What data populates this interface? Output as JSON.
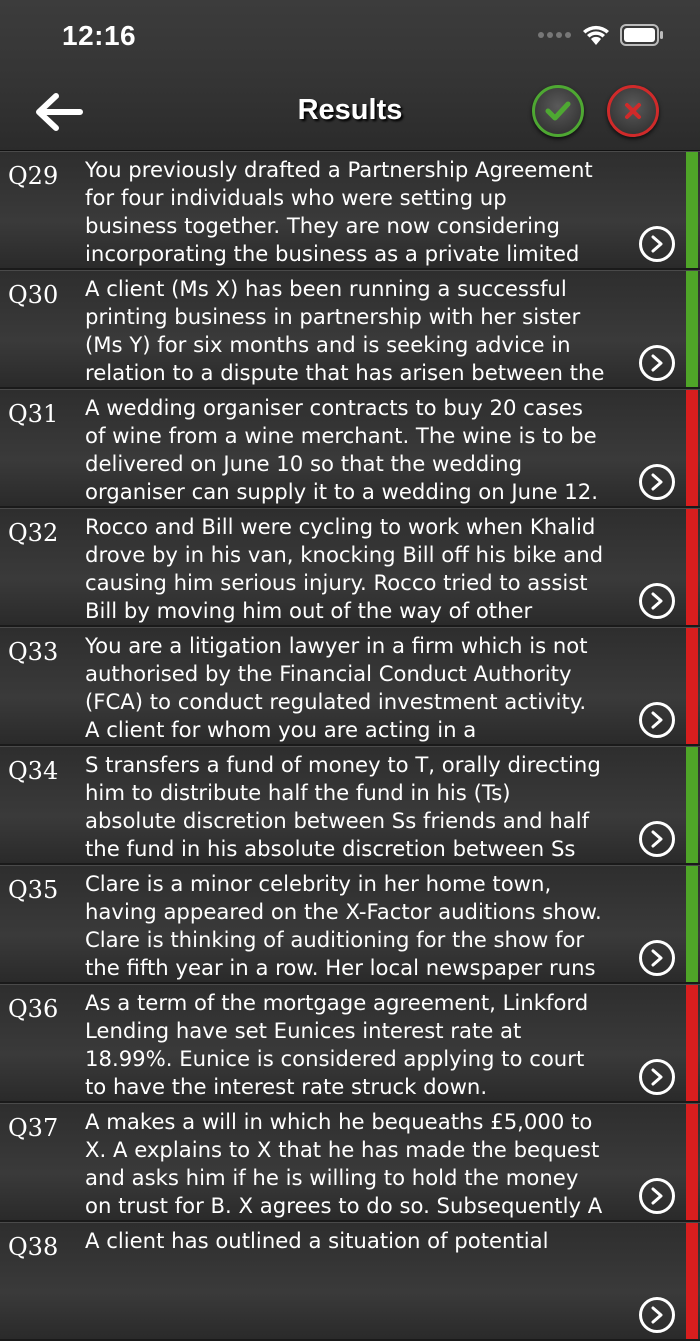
{
  "status": {
    "time": "12:16"
  },
  "header": {
    "title": "Results"
  },
  "colors": {
    "correct": "#4fa528",
    "incorrect": "#d81e1e"
  },
  "questions": [
    {
      "number": "Q29",
      "result": "correct",
      "text": "You previously drafted a Partnership Agreement for four individuals who were setting up business together. They are now considering incorporating the business as a private limited company but are"
    },
    {
      "number": "Q30",
      "result": "correct",
      "text": "A client (Ms X) has been running a successful printing business in partnership with her sister (Ms Y) for six months and is seeking advice in relation to a dispute that has arisen between the"
    },
    {
      "number": "Q31",
      "result": "incorrect",
      "text": "A wedding organiser contracts to buy 20 cases of wine from a wine merchant. The wine is to be delivered on June 10 so that the wedding organiser can supply it to a wedding on June 12."
    },
    {
      "number": "Q32",
      "result": "incorrect",
      "text": "Rocco and Bill were cycling to work when Khalid drove by in his van, knocking Bill off his bike and causing him serious injury. Rocco tried to assist Bill by moving him out of the way of other"
    },
    {
      "number": "Q33",
      "result": "incorrect",
      "text": "You are a litigation lawyer in a firm which is not authorised by the Financial Conduct Authority (FCA) to conduct regulated investment activity. A client for whom you are acting in a"
    },
    {
      "number": "Q34",
      "result": "correct",
      "text": "S transfers a fund of money to T, orally directing him to distribute half the fund in his (Ts) absolute discretion between Ss friends and half the fund in his absolute discretion between Ss relatives."
    },
    {
      "number": "Q35",
      "result": "correct",
      "text": "Clare is a minor celebrity in her home town, having appeared on the X-Factor auditions show. Clare is thinking of auditioning for the show for the fifth year in a row. Her local newspaper runs"
    },
    {
      "number": "Q36",
      "result": "incorrect",
      "text": "As a term of the mortgage agreement, Linkford Lending have set Eunices interest rate at 18.99%. Eunice is considered applying to court to have the interest rate struck down."
    },
    {
      "number": "Q37",
      "result": "incorrect",
      "text": "A makes a will in which he bequeaths £5,000 to X. A explains to X that he has made the bequest and asks him if he is willing to hold the money on trust for B. X agrees to do so. Subsequently A"
    },
    {
      "number": "Q38",
      "result": "incorrect",
      "text": "A client has outlined a situation of potential"
    }
  ]
}
